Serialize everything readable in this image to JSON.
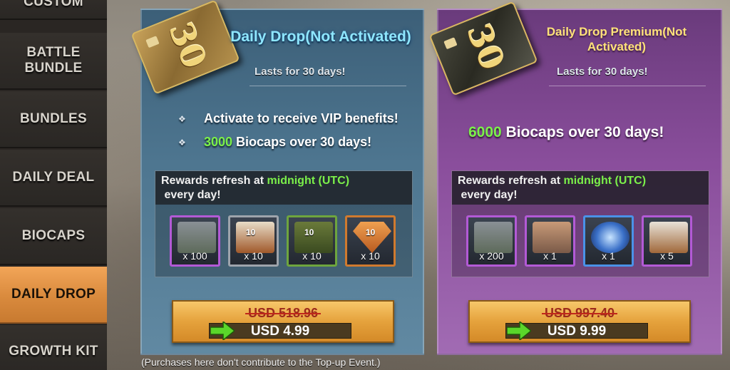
{
  "sidebar": {
    "items": [
      {
        "label": "CUSTOM",
        "active": false
      },
      {
        "label": "BATTLE\nBUNDLE",
        "active": false
      },
      {
        "label": "BUNDLES",
        "active": false
      },
      {
        "label": "DAILY DEAL",
        "active": false
      },
      {
        "label": "BIOCAPS",
        "active": false
      },
      {
        "label": "DAILY DROP",
        "active": true
      },
      {
        "label": "GROWTH KIT",
        "active": false
      }
    ]
  },
  "basic": {
    "voucher_number": "30",
    "title": "Daily Drop(Not Activated)",
    "lasts": "Lasts for 30 days!",
    "benefit_1": "Activate to receive VIP benefits!",
    "benefit_2_amount": "3000",
    "benefit_2_text": " Biocaps over 30 days!",
    "rewards_prefix": "Rewards refresh at ",
    "rewards_highlight": "midnight (UTC)",
    "rewards_suffix": " every day!",
    "items": [
      {
        "qty": "x 100",
        "tag": "",
        "icon": "biocap-canister-icon",
        "rarity": "purple"
      },
      {
        "qty": "x 10",
        "tag": "10",
        "icon": "supply-crate-icon",
        "rarity": "grey"
      },
      {
        "qty": "x 10",
        "tag": "10",
        "icon": "green-crate-icon",
        "rarity": "green"
      },
      {
        "qty": "x 10",
        "tag": "10",
        "icon": "orange-badge-icon",
        "rarity": "orange"
      }
    ],
    "old_price": "USD 518.96",
    "price": "USD 4.99"
  },
  "premium": {
    "voucher_number": "30",
    "title": "Daily Drop Premium(Not Activated)",
    "lasts": "Lasts for 30 days!",
    "benefit_amount": "6000",
    "benefit_text": " Biocaps over 30 days!",
    "rewards_prefix": "Rewards refresh at ",
    "rewards_highlight": "midnight (UTC)",
    "rewards_suffix": " every day!",
    "items": [
      {
        "qty": "x 200",
        "icon": "biocap-canister-icon",
        "rarity": "purple"
      },
      {
        "qty": "x 1",
        "icon": "map-blueprint-icon",
        "rarity": "purple"
      },
      {
        "qty": "x 1",
        "icon": "blue-star-badge-icon",
        "rarity": "blue"
      },
      {
        "qty": "x 5",
        "icon": "document-pack-icon",
        "rarity": "purple"
      }
    ],
    "old_price": "USD 997.40",
    "price": "USD 9.99"
  },
  "footnote": "(Purchases here don't contribute to the Top-up Event.)"
}
